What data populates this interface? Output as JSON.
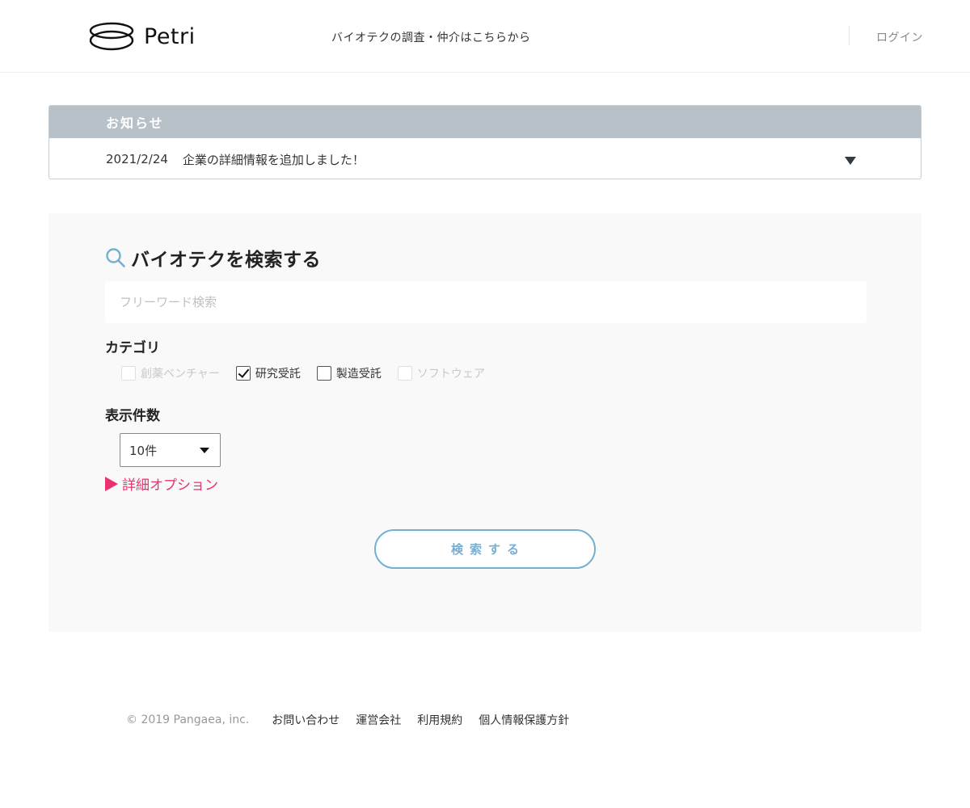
{
  "header": {
    "logo_text": "Petri",
    "tagline": "バイオテクの調査・仲介はこちらから",
    "login_label": "ログイン"
  },
  "notice": {
    "heading": "お知らせ",
    "date": "2021/2/24",
    "text": "企業の詳細情報を追加しました！"
  },
  "search": {
    "title": "バイオテクを検索する",
    "placeholder": "フリーワード検索",
    "category_label": "カテゴリ",
    "categories": [
      {
        "label": "創薬ベンチャー",
        "checked": false,
        "disabled": true
      },
      {
        "label": "研究受託",
        "checked": true,
        "disabled": false
      },
      {
        "label": "製造受託",
        "checked": false,
        "disabled": false
      },
      {
        "label": "ソフトウェア",
        "checked": false,
        "disabled": true
      }
    ],
    "count_label": "表示件数",
    "count_value": "10件",
    "detail_label": "詳細オプション",
    "button_label": "検索する"
  },
  "footer": {
    "copyright": "© 2019 Pangaea, inc.",
    "links": [
      "お問い合わせ",
      "運営会社",
      "利用規約",
      "個人情報保護方針"
    ]
  },
  "colors": {
    "accent_blue": "#77aed3",
    "accent_pink": "#e8336e",
    "notice_header": "#b8c1c8",
    "panel_bg": "#f9f9f9"
  }
}
